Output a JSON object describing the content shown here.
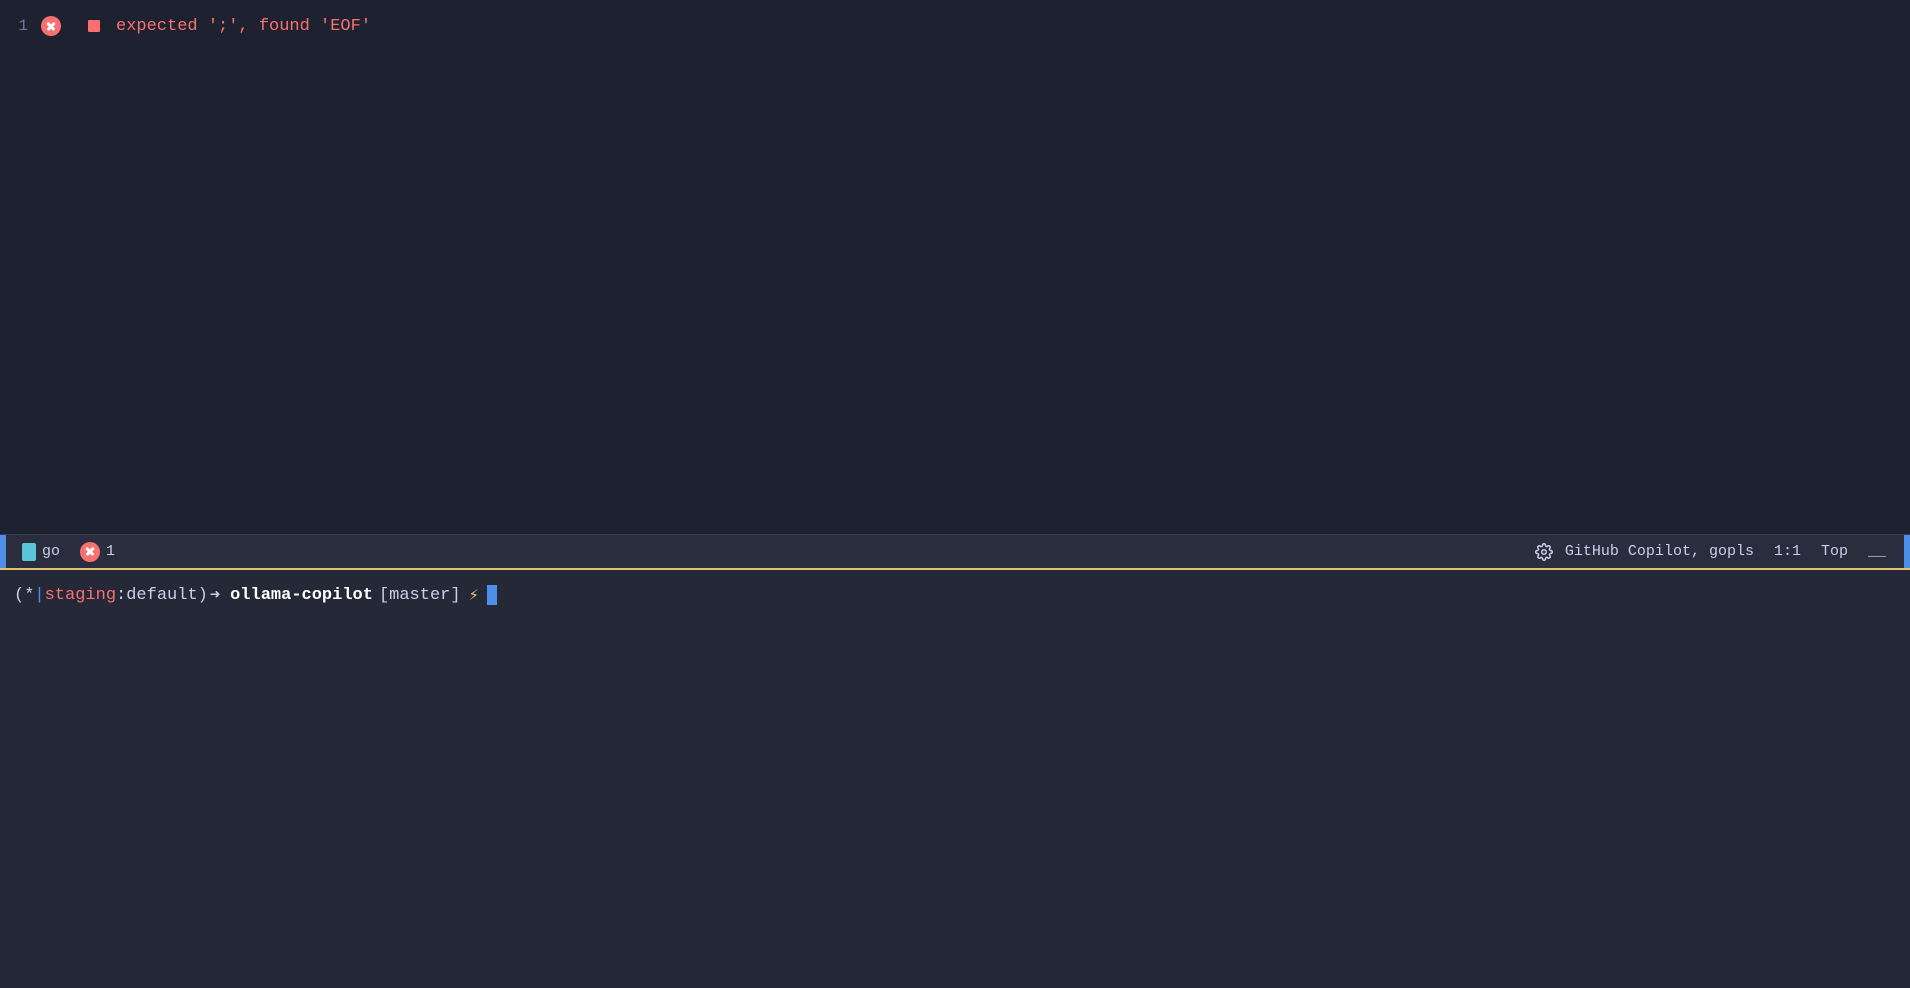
{
  "editor": {
    "background_color": "#1e2130",
    "lines": [
      {
        "number": "1",
        "has_error": true,
        "message": "expected ';', found 'EOF'"
      }
    ]
  },
  "status_bar": {
    "language": "go",
    "error_count": "1",
    "copilot_label": "GitHub Copilot, gopls",
    "position": "1:1",
    "scroll_position": "Top",
    "background_color": "#2a2d3e",
    "accent_color": "#4d8ee8",
    "border_color": "#e5c07b"
  },
  "terminal": {
    "prompt": {
      "open_paren": "(*",
      "pipe": "|",
      "context": "staging",
      "colon": ":",
      "namespace": "default",
      "close_paren": ")",
      "arrow": "➜",
      "project": "ollama-copilot",
      "branch": "[master]",
      "lightning": "⚡"
    },
    "background_color": "#252837"
  }
}
